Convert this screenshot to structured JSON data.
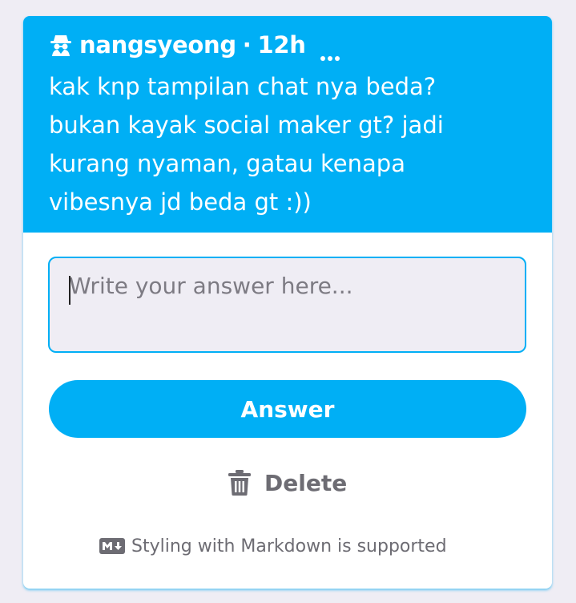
{
  "question": {
    "author": "nangsyeong",
    "separator": "·",
    "time": "12h",
    "text": "kak knp tampilan chat nya beda?\nbukan kayak social maker gt? jadi\nkurang nyaman, gatau kenapa\nvibesnya jd beda gt :))",
    "author_icon": "anonymous-spy-icon",
    "more_icon": "more-options-icon"
  },
  "answer_form": {
    "placeholder": "Write your answer here...",
    "value": "",
    "submit_label": "Answer"
  },
  "delete": {
    "label": "Delete",
    "icon": "trash-icon"
  },
  "footer": {
    "markdown_note": "Styling with Markdown is supported",
    "icon": "markdown-icon"
  },
  "colors": {
    "accent": "#00aff5",
    "background": "#efedf4",
    "muted_text": "#6d6c73"
  }
}
